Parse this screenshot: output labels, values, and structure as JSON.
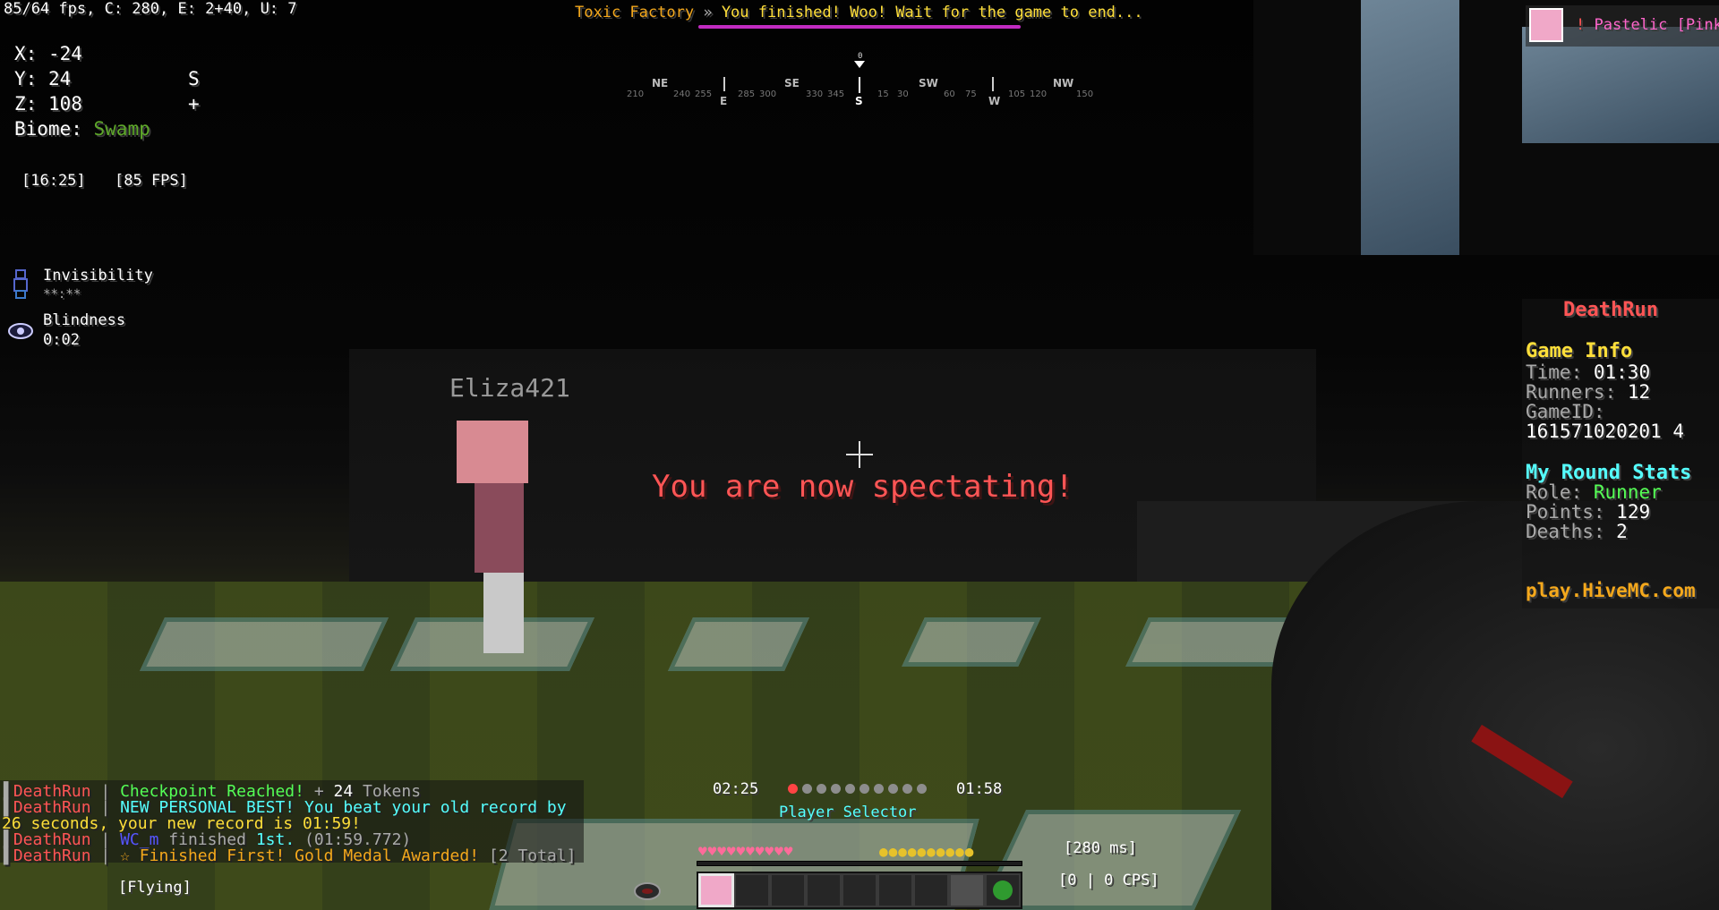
{
  "debug": {
    "fps_line": "85/64 fps, C: 280, E: 2+40, U: 7",
    "x_label": "X:",
    "x_value": "-24",
    "y_label": "Y:",
    "y_value": "24",
    "z_label": "Z:",
    "z_value": "108",
    "facing_letter": "S",
    "facing_plus": "+",
    "biome_label": "Biome:",
    "biome_value": "Swamp",
    "clock": "[16:25]",
    "fps_badge": "[85 FPS]"
  },
  "effects": [
    {
      "name": "Invisibility",
      "time": "**:**"
    },
    {
      "name": "Blindness",
      "time": "0:02"
    }
  ],
  "title_bar": {
    "map": "Toxic Factory",
    "separator": "»",
    "message": "You finished! Woo! Wait for the game to end..."
  },
  "compass": {
    "pointer_value": "0",
    "labels": [
      "NE",
      "SE",
      "SW",
      "NW"
    ],
    "cardinals": [
      "E",
      "S",
      "W"
    ],
    "degrees": [
      "210",
      "240",
      "255",
      "285",
      "300",
      "330",
      "345",
      "15",
      "30",
      "60",
      "75",
      "105",
      "120",
      "150"
    ]
  },
  "player_tag": "Eliza421",
  "center_message": "You are now spectating!",
  "top_right": {
    "prefix": "!",
    "name": "Pastelic",
    "tag": "[Pink]"
  },
  "sidebar": {
    "title": "DeathRun",
    "game_info_header": "Game Info",
    "time_label": "Time:",
    "time_value": "01:30",
    "runners_label": "Runners:",
    "runners_value": "12",
    "gameid_label": "GameID:",
    "gameid_value": "161571020201 4",
    "round_header": "My Round Stats",
    "role_label": "Role:",
    "role_value": "Runner",
    "points_label": "Points:",
    "points_value": "129",
    "deaths_label": "Deaths:",
    "deaths_value": "2",
    "footer": "play.HiveMC.com"
  },
  "chat": {
    "line1": {
      "tag": "DeathRun",
      "sep": "|",
      "msg": "Checkpoint Reached!",
      "tail_plus": "+",
      "tokens": "24",
      "tokens_word": "Tokens"
    },
    "line2": {
      "tag": "DeathRun",
      "sep": "|",
      "msg": "NEW PERSONAL BEST!",
      "rest": "You beat your old record by"
    },
    "line3": {
      "text": "26 seconds, your new record is 01:59!"
    },
    "line4": {
      "tag": "DeathRun",
      "sep": "|",
      "player": "WC_m",
      "finished": "finished",
      "place": "1st.",
      "time": "(01:59.772)"
    },
    "line5": {
      "tag": "DeathRun",
      "sep": "|",
      "star": "☆",
      "msg": "Finished First! Gold Medal Awarded!",
      "total": "[2 Total]"
    }
  },
  "timers": {
    "left": "02:25",
    "right": "01:58"
  },
  "player_selector": "Player Selector",
  "status": {
    "flying": "[Flying]",
    "ping": "[280 ms]",
    "cps": "[0 | 0 CPS]"
  },
  "hud": {
    "hearts": "♥♥♥♥♥♥♥♥♥♥",
    "hunger": "●●●●●●●●●●",
    "spectator_dots_total": 10,
    "spectator_dots_active": 1
  }
}
